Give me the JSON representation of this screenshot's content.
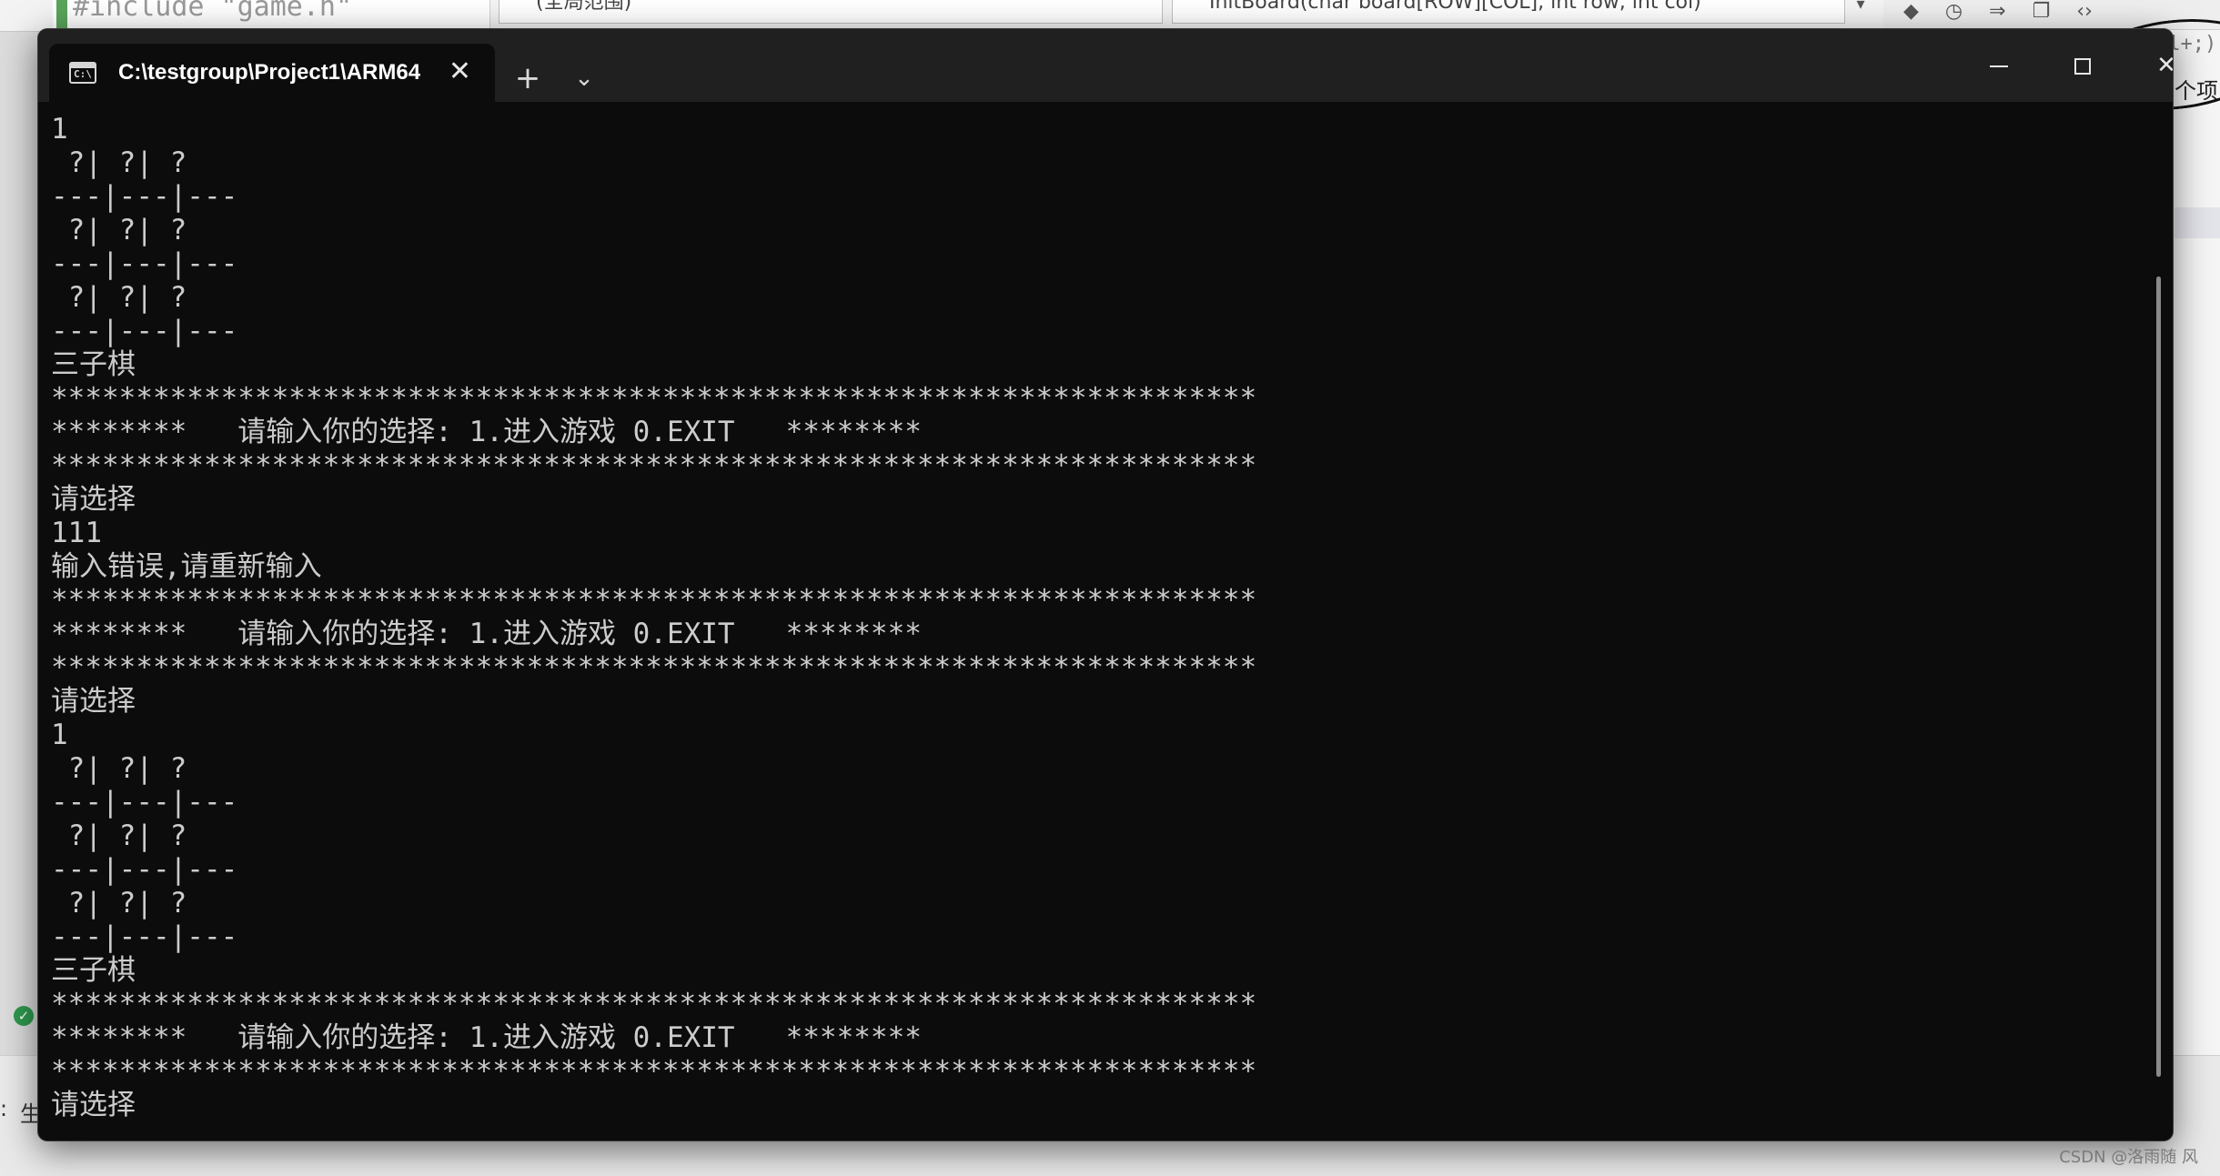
{
  "ide": {
    "code_snippet": "#include \"game.h\"",
    "dropdown_left": "(全局范围)",
    "dropdown_right": "InitBoard(char board[ROW][COL], int row, int col)",
    "right_text_1": "rl+;)",
    "right_text_2": "个项",
    "bottom_label": "生"
  },
  "terminal": {
    "tab_title": "C:\\testgroup\\Project1\\ARM64",
    "lines": [
      "1",
      " ?| ?| ?",
      "---|---|---",
      " ?| ?| ?",
      "---|---|---",
      " ?| ?| ?",
      "---|---|---",
      "三子棋",
      "***********************************************************************",
      "********   请输入你的选择: 1.进入游戏 0.EXIT   ********",
      "***********************************************************************",
      "请选择",
      "111",
      "输入错误,请重新输入",
      "***********************************************************************",
      "********   请输入你的选择: 1.进入游戏 0.EXIT   ********",
      "***********************************************************************",
      "请选择",
      "1",
      " ?| ?| ?",
      "---|---|---",
      " ?| ?| ?",
      "---|---|---",
      " ?| ?| ?",
      "---|---|---",
      "三子棋",
      "***********************************************************************",
      "********   请输入你的选择: 1.进入游戏 0.EXIT   ********",
      "***********************************************************************",
      "请选择"
    ]
  },
  "watermark": "CSDN @洛雨随 风",
  "icons": {
    "tab": "console-icon",
    "close": "close-icon",
    "new_tab": "plus-icon",
    "dropdown": "chevron-down-icon",
    "minimize": "minimize-icon",
    "maximize": "maximize-icon"
  },
  "colors": {
    "terminal_bg": "#0c0c0c",
    "titlebar_bg": "#202020",
    "text": "#cccccc"
  }
}
